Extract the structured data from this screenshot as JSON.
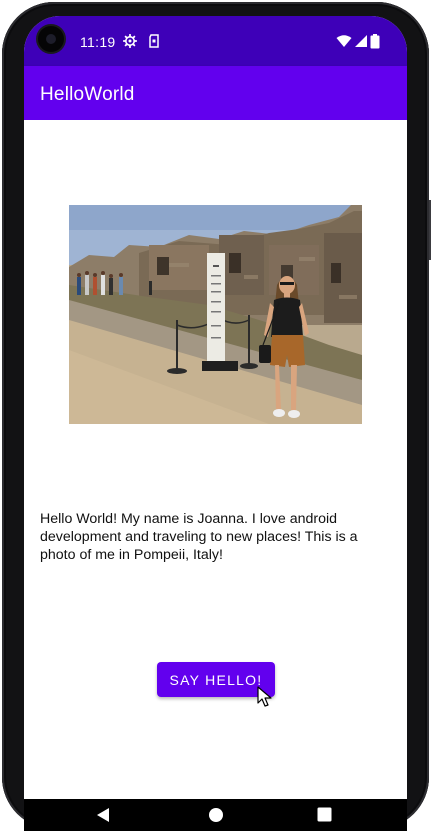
{
  "status_bar": {
    "time": "11:19",
    "left_icons": [
      "gear-icon",
      "sim-card-icon"
    ],
    "right_icons": [
      "wifi-icon",
      "cellular-signal-icon",
      "battery-icon"
    ],
    "color": "#3e00b8"
  },
  "app_bar": {
    "title": "HelloWorld",
    "color": "#6200ee"
  },
  "main": {
    "photo_icon": "photo-image",
    "intro": "Hello World! My name is Joanna. I love android development and traveling to new places! This is a photo of me in Pompeii, Italy!",
    "button_label": "SAY HELLO!",
    "button_color": "#6200ee"
  },
  "nav_bar": {
    "buttons": [
      "back-icon",
      "home-icon",
      "recents-icon"
    ]
  }
}
